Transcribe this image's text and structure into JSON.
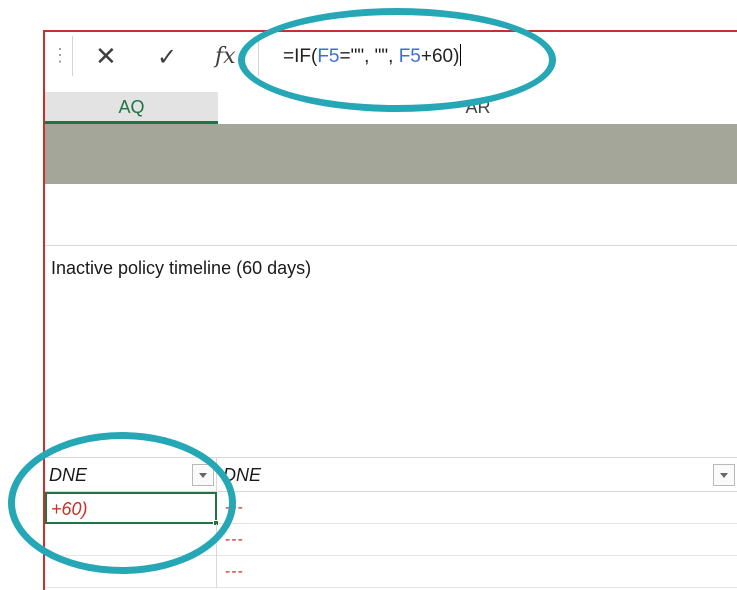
{
  "formula_bar": {
    "grip_icon": "vertical-dots",
    "cancel_icon": "✕",
    "enter_icon": "✓",
    "fx_label": "fx",
    "formula_parts": [
      "=IF(",
      "F5",
      "=\"\", \"\", ",
      "F5",
      "+60)"
    ]
  },
  "columns": {
    "aq": "AQ",
    "ar": "AR"
  },
  "rows": {
    "description": "Inactive policy timeline (60 days)",
    "table_header_aq": "DNE",
    "table_header_ar": "DNE",
    "data": [
      {
        "aq": "+60)",
        "ar": "---"
      },
      {
        "aq": "",
        "ar": "---"
      },
      {
        "aq": "",
        "ar": "---"
      }
    ]
  },
  "colors": {
    "accent_green": "#217346",
    "annotation_teal": "#25a7b6",
    "error_red": "#c9302c",
    "header_grey": "#a5a69a"
  }
}
